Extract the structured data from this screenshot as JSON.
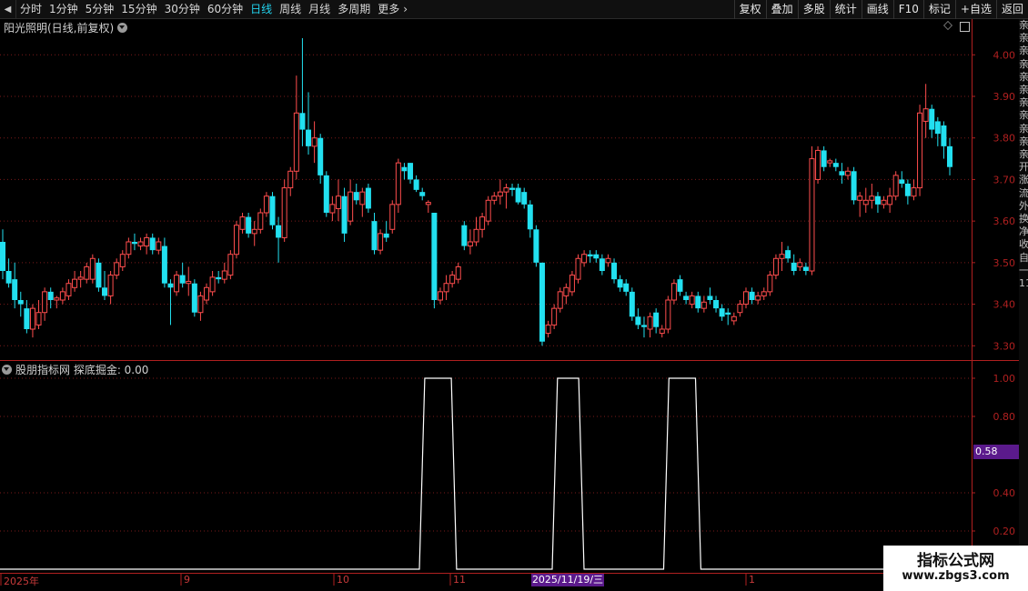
{
  "toolbar": {
    "periods": [
      "分时",
      "1分钟",
      "5分钟",
      "15分钟",
      "30分钟",
      "60分钟",
      "日线",
      "周线",
      "月线",
      "多周期",
      "更多"
    ],
    "active_period": "日线",
    "right_buttons": [
      "复权",
      "叠加",
      "多股",
      "统计",
      "画线",
      "F10",
      "标记",
      "+自选",
      "返回"
    ]
  },
  "main_pane": {
    "title": "阳光照明(日线,前复权)",
    "price_labels": [
      "4.00",
      "3.90",
      "3.80",
      "3.70",
      "3.60",
      "3.50",
      "3.40",
      "3.30"
    ]
  },
  "indicator_pane": {
    "title": "股朋指标网 探底掘金: 0.00",
    "value_labels": [
      "1.00",
      "0.80",
      "0.40",
      "0.20"
    ],
    "current_value": "0.58"
  },
  "time_axis": {
    "labels": [
      "2025年",
      "9",
      "10",
      "11",
      "1"
    ],
    "selected_date": "2025/11/19/三"
  },
  "right_strip": {
    "text": "亲亲亲亲亲亲亲亲亲亲亲开涨流外换净收自一1111111"
  },
  "watermark": {
    "title": "指标公式网",
    "url": "www.zbgs3.com"
  },
  "colors": {
    "up": "#ff4d4d",
    "down": "#22e0f0",
    "grid": "#7a1a1a",
    "axis": "#b02020",
    "active": "#22d3ee",
    "signal": "#ffffff",
    "badge": "#5b1a8c"
  },
  "chart_data": [
    {
      "type": "candlestick",
      "title": "阳光照明(日线,前复权)",
      "ylim": [
        3.27,
        4.04
      ],
      "candles": [
        [
          3.55,
          3.58,
          3.46,
          3.48
        ],
        [
          3.48,
          3.51,
          3.44,
          3.45
        ],
        [
          3.46,
          3.5,
          3.39,
          3.41
        ],
        [
          3.41,
          3.43,
          3.37,
          3.4
        ],
        [
          3.39,
          3.41,
          3.33,
          3.34
        ],
        [
          3.34,
          3.4,
          3.32,
          3.39
        ],
        [
          3.35,
          3.41,
          3.34,
          3.38
        ],
        [
          3.38,
          3.44,
          3.36,
          3.43
        ],
        [
          3.43,
          3.44,
          3.39,
          3.41
        ],
        [
          3.41,
          3.42,
          3.39,
          3.415
        ],
        [
          3.41,
          3.44,
          3.4,
          3.43
        ],
        [
          3.42,
          3.46,
          3.41,
          3.45
        ],
        [
          3.44,
          3.48,
          3.43,
          3.46
        ],
        [
          3.46,
          3.48,
          3.44,
          3.465
        ],
        [
          3.46,
          3.5,
          3.45,
          3.49
        ],
        [
          3.46,
          3.52,
          3.45,
          3.51
        ],
        [
          3.5,
          3.51,
          3.43,
          3.44
        ],
        [
          3.44,
          3.48,
          3.41,
          3.42
        ],
        [
          3.42,
          3.48,
          3.4,
          3.47
        ],
        [
          3.47,
          3.51,
          3.46,
          3.5
        ],
        [
          3.49,
          3.53,
          3.48,
          3.52
        ],
        [
          3.52,
          3.56,
          3.51,
          3.55
        ],
        [
          3.55,
          3.57,
          3.53,
          3.545
        ],
        [
          3.54,
          3.56,
          3.53,
          3.55
        ],
        [
          3.54,
          3.57,
          3.52,
          3.56
        ],
        [
          3.56,
          3.57,
          3.52,
          3.53
        ],
        [
          3.53,
          3.56,
          3.52,
          3.55
        ],
        [
          3.54,
          3.56,
          3.44,
          3.45
        ],
        [
          3.45,
          3.46,
          3.35,
          3.44
        ],
        [
          3.43,
          3.48,
          3.42,
          3.47
        ],
        [
          3.47,
          3.5,
          3.44,
          3.45
        ],
        [
          3.45,
          3.49,
          3.42,
          3.455
        ],
        [
          3.45,
          3.46,
          3.37,
          3.38
        ],
        [
          3.38,
          3.43,
          3.36,
          3.42
        ],
        [
          3.41,
          3.45,
          3.4,
          3.44
        ],
        [
          3.43,
          3.48,
          3.42,
          3.465
        ],
        [
          3.465,
          3.48,
          3.45,
          3.46
        ],
        [
          3.46,
          3.5,
          3.45,
          3.48
        ],
        [
          3.47,
          3.53,
          3.46,
          3.52
        ],
        [
          3.52,
          3.6,
          3.51,
          3.59
        ],
        [
          3.58,
          3.62,
          3.57,
          3.61
        ],
        [
          3.61,
          3.62,
          3.56,
          3.57
        ],
        [
          3.57,
          3.6,
          3.54,
          3.58
        ],
        [
          3.58,
          3.63,
          3.57,
          3.62
        ],
        [
          3.62,
          3.67,
          3.61,
          3.66
        ],
        [
          3.66,
          3.67,
          3.58,
          3.59
        ],
        [
          3.59,
          3.61,
          3.5,
          3.56
        ],
        [
          3.56,
          3.7,
          3.55,
          3.68
        ],
        [
          3.68,
          3.73,
          3.66,
          3.72
        ],
        [
          3.72,
          3.95,
          3.7,
          3.86
        ],
        [
          3.86,
          4.04,
          3.78,
          3.82
        ],
        [
          3.82,
          3.91,
          3.76,
          3.78
        ],
        [
          3.78,
          3.84,
          3.74,
          3.8
        ],
        [
          3.8,
          3.81,
          3.69,
          3.71
        ],
        [
          3.71,
          3.72,
          3.61,
          3.62
        ],
        [
          3.62,
          3.66,
          3.6,
          3.64
        ],
        [
          3.63,
          3.7,
          3.6,
          3.66
        ],
        [
          3.66,
          3.68,
          3.55,
          3.57
        ],
        [
          3.6,
          3.7,
          3.59,
          3.67
        ],
        [
          3.67,
          3.69,
          3.64,
          3.65
        ],
        [
          3.64,
          3.68,
          3.61,
          3.67
        ],
        [
          3.68,
          3.69,
          3.62,
          3.63
        ],
        [
          3.6,
          3.62,
          3.52,
          3.53
        ],
        [
          3.53,
          3.58,
          3.52,
          3.57
        ],
        [
          3.57,
          3.6,
          3.55,
          3.56
        ],
        [
          3.58,
          3.65,
          3.57,
          3.64
        ],
        [
          3.64,
          3.75,
          3.62,
          3.74
        ],
        [
          3.73,
          3.74,
          3.7,
          3.72
        ],
        [
          3.74,
          3.74,
          3.69,
          3.7
        ],
        [
          3.7,
          3.71,
          3.67,
          3.675
        ],
        [
          3.67,
          3.68,
          3.65,
          3.66
        ],
        [
          3.64,
          3.65,
          3.62,
          3.645
        ],
        [
          3.62,
          3.62,
          3.39,
          3.41
        ],
        [
          3.41,
          3.44,
          3.4,
          3.43
        ],
        [
          3.43,
          3.47,
          3.41,
          3.45
        ],
        [
          3.45,
          3.48,
          3.44,
          3.47
        ],
        [
          3.46,
          3.5,
          3.45,
          3.49
        ],
        [
          3.59,
          3.6,
          3.53,
          3.54
        ],
        [
          3.54,
          3.58,
          3.52,
          3.55
        ],
        [
          3.55,
          3.61,
          3.54,
          3.58
        ],
        [
          3.58,
          3.62,
          3.56,
          3.61
        ],
        [
          3.6,
          3.66,
          3.59,
          3.65
        ],
        [
          3.65,
          3.67,
          3.64,
          3.66
        ],
        [
          3.66,
          3.7,
          3.64,
          3.67
        ],
        [
          3.67,
          3.69,
          3.63,
          3.68
        ],
        [
          3.68,
          3.69,
          3.66,
          3.675
        ],
        [
          3.68,
          3.69,
          3.64,
          3.645
        ],
        [
          3.67,
          3.68,
          3.63,
          3.64
        ],
        [
          3.64,
          3.65,
          3.56,
          3.58
        ],
        [
          3.58,
          3.59,
          3.49,
          3.5
        ],
        [
          3.5,
          3.5,
          3.3,
          3.31
        ],
        [
          3.33,
          3.36,
          3.32,
          3.35
        ],
        [
          3.35,
          3.4,
          3.34,
          3.39
        ],
        [
          3.39,
          3.44,
          3.38,
          3.43
        ],
        [
          3.42,
          3.45,
          3.4,
          3.44
        ],
        [
          3.43,
          3.48,
          3.42,
          3.47
        ],
        [
          3.46,
          3.52,
          3.45,
          3.51
        ],
        [
          3.5,
          3.53,
          3.49,
          3.52
        ],
        [
          3.52,
          3.53,
          3.5,
          3.515
        ],
        [
          3.52,
          3.53,
          3.5,
          3.51
        ],
        [
          3.51,
          3.52,
          3.47,
          3.48
        ],
        [
          3.5,
          3.52,
          3.49,
          3.51
        ],
        [
          3.5,
          3.51,
          3.45,
          3.46
        ],
        [
          3.46,
          3.47,
          3.43,
          3.44
        ],
        [
          3.45,
          3.46,
          3.42,
          3.43
        ],
        [
          3.43,
          3.44,
          3.36,
          3.37
        ],
        [
          3.37,
          3.39,
          3.34,
          3.35
        ],
        [
          3.35,
          3.37,
          3.32,
          3.345
        ],
        [
          3.34,
          3.38,
          3.32,
          3.37
        ],
        [
          3.38,
          3.39,
          3.33,
          3.345
        ],
        [
          3.33,
          3.35,
          3.32,
          3.34
        ],
        [
          3.34,
          3.42,
          3.33,
          3.41
        ],
        [
          3.41,
          3.46,
          3.4,
          3.45
        ],
        [
          3.46,
          3.47,
          3.42,
          3.43
        ],
        [
          3.42,
          3.43,
          3.4,
          3.41
        ],
        [
          3.4,
          3.43,
          3.39,
          3.42
        ],
        [
          3.42,
          3.43,
          3.38,
          3.39
        ],
        [
          3.39,
          3.42,
          3.38,
          3.405
        ],
        [
          3.42,
          3.44,
          3.4,
          3.41
        ],
        [
          3.41,
          3.42,
          3.38,
          3.39
        ],
        [
          3.39,
          3.4,
          3.36,
          3.37
        ],
        [
          3.38,
          3.39,
          3.35,
          3.375
        ],
        [
          3.36,
          3.38,
          3.35,
          3.37
        ],
        [
          3.38,
          3.41,
          3.37,
          3.4
        ],
        [
          3.4,
          3.44,
          3.39,
          3.43
        ],
        [
          3.43,
          3.44,
          3.4,
          3.41
        ],
        [
          3.41,
          3.43,
          3.4,
          3.42
        ],
        [
          3.42,
          3.44,
          3.41,
          3.43
        ],
        [
          3.43,
          3.48,
          3.42,
          3.47
        ],
        [
          3.47,
          3.52,
          3.46,
          3.51
        ],
        [
          3.51,
          3.55,
          3.48,
          3.52
        ],
        [
          3.53,
          3.54,
          3.5,
          3.51
        ],
        [
          3.5,
          3.52,
          3.47,
          3.48
        ],
        [
          3.49,
          3.51,
          3.48,
          3.5
        ],
        [
          3.49,
          3.5,
          3.47,
          3.48
        ],
        [
          3.48,
          3.78,
          3.47,
          3.75
        ],
        [
          3.7,
          3.78,
          3.69,
          3.77
        ],
        [
          3.77,
          3.78,
          3.72,
          3.73
        ],
        [
          3.74,
          3.75,
          3.73,
          3.745
        ],
        [
          3.74,
          3.75,
          3.72,
          3.73
        ],
        [
          3.72,
          3.74,
          3.69,
          3.71
        ],
        [
          3.71,
          3.73,
          3.7,
          3.72
        ],
        [
          3.72,
          3.73,
          3.64,
          3.65
        ],
        [
          3.65,
          3.67,
          3.61,
          3.66
        ],
        [
          3.64,
          3.68,
          3.62,
          3.65
        ],
        [
          3.65,
          3.69,
          3.63,
          3.66
        ],
        [
          3.66,
          3.67,
          3.62,
          3.64
        ],
        [
          3.64,
          3.66,
          3.63,
          3.65
        ],
        [
          3.64,
          3.68,
          3.62,
          3.66
        ],
        [
          3.66,
          3.72,
          3.65,
          3.71
        ],
        [
          3.7,
          3.72,
          3.68,
          3.69
        ],
        [
          3.69,
          3.7,
          3.64,
          3.66
        ],
        [
          3.66,
          3.7,
          3.65,
          3.68
        ],
        [
          3.68,
          3.88,
          3.66,
          3.86
        ],
        [
          3.84,
          3.93,
          3.8,
          3.87
        ],
        [
          3.87,
          3.88,
          3.8,
          3.82
        ],
        [
          3.84,
          3.85,
          3.78,
          3.81
        ],
        [
          3.83,
          3.84,
          3.75,
          3.78
        ],
        [
          3.78,
          3.8,
          3.71,
          3.73
        ]
      ]
    },
    {
      "type": "line",
      "title": "股朋指标网 探底掘金: 0.00",
      "ylim": [
        0,
        1.0
      ],
      "values": [
        0,
        0,
        0,
        0,
        0,
        0,
        0,
        0,
        0,
        0,
        0,
        0,
        0,
        0,
        0,
        0,
        0,
        0,
        0,
        0,
        0,
        0,
        0,
        0,
        0,
        0,
        0,
        0,
        0,
        0,
        0,
        0,
        0,
        0,
        0,
        0,
        0,
        0,
        0,
        0,
        0,
        0,
        0,
        0,
        0,
        0,
        0,
        0,
        0,
        0,
        0,
        0,
        0,
        0,
        0,
        0,
        0,
        0,
        0,
        0,
        0,
        0,
        0,
        0,
        0,
        0,
        0,
        0,
        0,
        0,
        0,
        0,
        0,
        0,
        0,
        0,
        0,
        0,
        0,
        0,
        1,
        1,
        1,
        1,
        1,
        1,
        0,
        0,
        0,
        0,
        0,
        0,
        0,
        0,
        0,
        0,
        0,
        0,
        0,
        0,
        0,
        0,
        0,
        0,
        0,
        1,
        1,
        1,
        1,
        1,
        0,
        0,
        0,
        0,
        0,
        0,
        0,
        0,
        0,
        0,
        0,
        0,
        0,
        0,
        0,
        0,
        1,
        1,
        1,
        1,
        1,
        1,
        0,
        0,
        0,
        0,
        0,
        0,
        0,
        0,
        0,
        0,
        0,
        0,
        0,
        0,
        0,
        0,
        0,
        0,
        0,
        0,
        0,
        0,
        0,
        0,
        0,
        0,
        0,
        0,
        0,
        0,
        0,
        0,
        0,
        0,
        0,
        0,
        0,
        0,
        0,
        0,
        0,
        0,
        0,
        0,
        0,
        0,
        0,
        0,
        0,
        0,
        0,
        0
      ]
    }
  ]
}
